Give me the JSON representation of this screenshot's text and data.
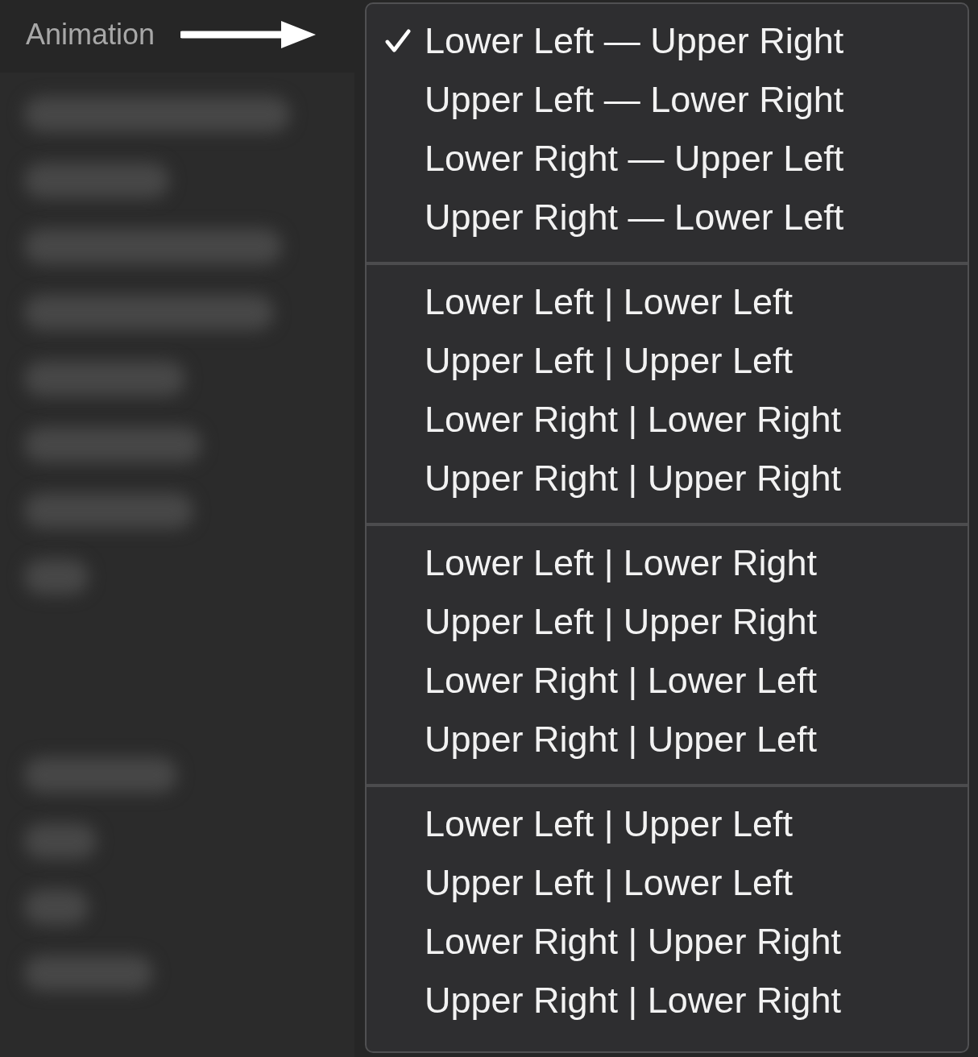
{
  "sidebar": {
    "label": "Animation"
  },
  "menu": {
    "groups": [
      {
        "items": [
          {
            "label": "Lower Left — Upper Right",
            "checked": true
          },
          {
            "label": "Upper Left — Lower Right",
            "checked": false
          },
          {
            "label": "Lower Right — Upper Left",
            "checked": false
          },
          {
            "label": "Upper Right — Lower Left",
            "checked": false
          }
        ]
      },
      {
        "items": [
          {
            "label": "Lower Left | Lower Left",
            "checked": false
          },
          {
            "label": "Upper Left | Upper Left",
            "checked": false
          },
          {
            "label": "Lower Right | Lower Right",
            "checked": false
          },
          {
            "label": "Upper Right | Upper Right",
            "checked": false
          }
        ]
      },
      {
        "items": [
          {
            "label": "Lower Left | Lower Right",
            "checked": false
          },
          {
            "label": "Upper Left | Upper Right",
            "checked": false
          },
          {
            "label": "Lower Right | Lower Left",
            "checked": false
          },
          {
            "label": "Upper Right | Upper Left",
            "checked": false
          }
        ]
      },
      {
        "items": [
          {
            "label": "Lower Left | Upper Left",
            "checked": false
          },
          {
            "label": "Upper Left | Lower Left",
            "checked": false
          },
          {
            "label": "Lower Right | Upper Right",
            "checked": false
          },
          {
            "label": "Upper Right | Lower Right",
            "checked": false
          }
        ]
      }
    ]
  }
}
